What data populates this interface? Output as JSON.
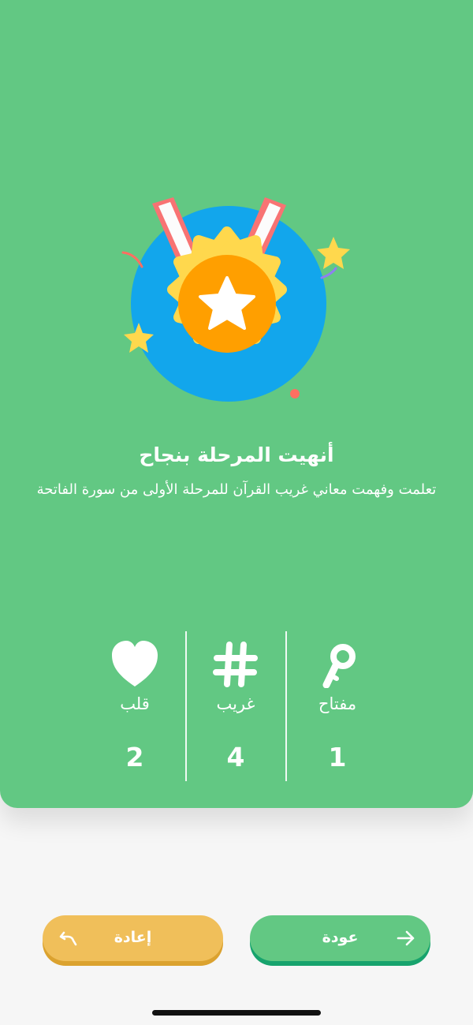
{
  "completion": {
    "title": "أنهيت المرحلة بنجاح",
    "subtitle": "تعلمت وفهمت معاني غريب القرآن للمرحلة الأولى من سورة الفاتحة"
  },
  "stats": [
    {
      "label": "مفتاح",
      "value": "1",
      "icon": "key-icon"
    },
    {
      "label": "غريب",
      "value": "4",
      "icon": "hash-icon"
    },
    {
      "label": "قلب",
      "value": "2",
      "icon": "heart-icon"
    }
  ],
  "buttons": {
    "back_label": "عودة",
    "retry_label": "إعادة"
  },
  "colors": {
    "card_green": "#62c883",
    "medal_blue": "#12a6ec",
    "medal_yellow": "#ffd84d",
    "medal_orange": "#ff9f00",
    "retry_yellow": "#f0bf5a",
    "back_shadow": "#17a36d"
  }
}
